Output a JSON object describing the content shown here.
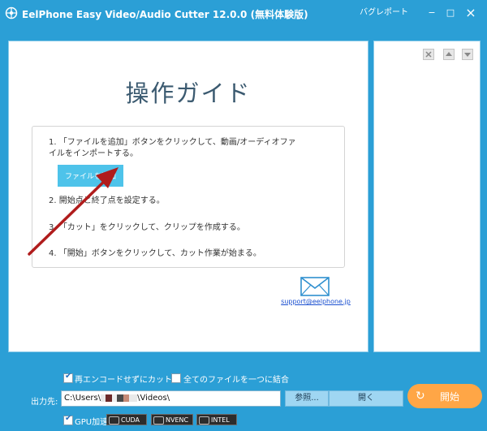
{
  "titlebar": {
    "title": "EelPhone Easy Video/Audio Cutter 12.0.0 (無料体験版)",
    "feedback": "バグレポート",
    "minimize": "−",
    "maximize": "□",
    "close": "×"
  },
  "guide": {
    "title": "操作ガイド",
    "step1_line1": "1. 「ファイルを追加」ボタンをクリックして、動画/オーディオファ",
    "step1_line2": "イルをインポートする。",
    "add_file_button": "ファイルを追加",
    "step2": "2. 開始点と終了点を設定する。",
    "step3": "3. 「カット」をクリックして、クリップを作成する。",
    "step4": "4. 「開始」ボタンをクリックして、カット作業が始まる。"
  },
  "support": {
    "email": "support@eelphone.jp"
  },
  "options": {
    "no_reencode": "再エンコードせずにカット",
    "no_reencode_checked": true,
    "merge_all": "全てのファイルを一つに結合",
    "merge_all_checked": false,
    "gpu_accel": "GPU加速",
    "gpu_accel_checked": true,
    "gpu_badges": [
      "CUDA",
      "NVENC",
      "INTEL"
    ]
  },
  "output": {
    "label": "出力先:",
    "path_prefix": "C:\\Users\\",
    "path_suffix": "\\Videos\\",
    "browse": "参照...",
    "open": "開く"
  },
  "start": {
    "label": "開始",
    "icon": "↻"
  },
  "colors": {
    "accent": "#2b9fd6",
    "add_button": "#4ec3ea",
    "start_button": "#ffa646",
    "arrow": "#b01c1c"
  }
}
